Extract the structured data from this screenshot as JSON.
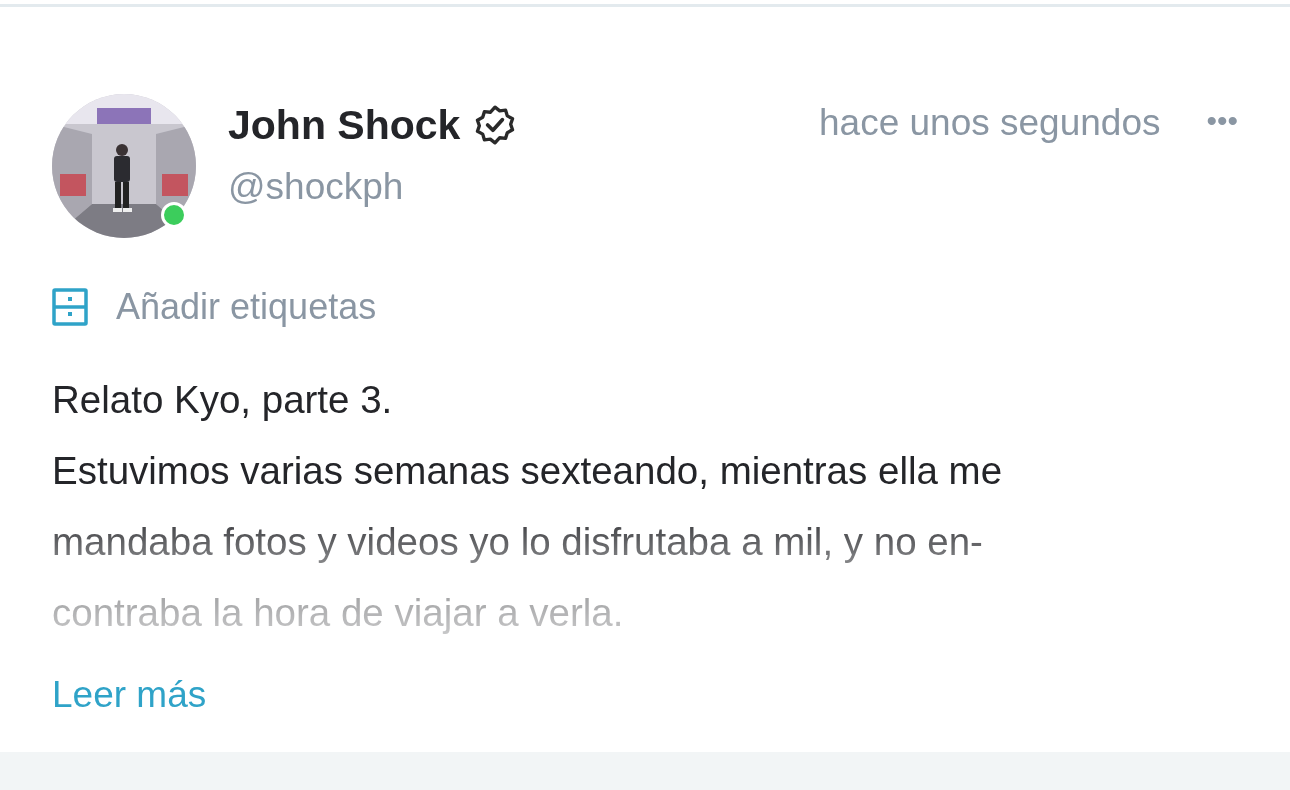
{
  "post": {
    "author": {
      "name": "John Shock",
      "verified": true,
      "handle": "@shockph",
      "online": true
    },
    "time": "hace unos segundos",
    "menu": "•••",
    "tags_action": "Añadir etiquetas",
    "text_lines": [
      "Relato Kyo, parte 3.",
      "Estuvimos varias semanas sexteando, mientras ella me",
      "mandaba fotos y videos yo lo disfrutaba a mil, y no en-",
      "contraba la hora de viajar a verla."
    ],
    "read_more": "Leer más"
  }
}
